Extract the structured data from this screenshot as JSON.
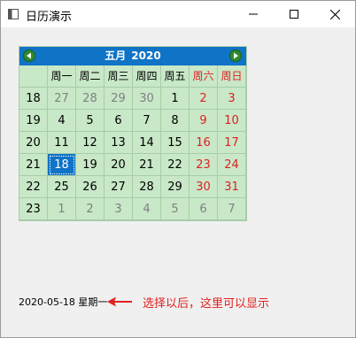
{
  "window": {
    "title": "日历演示"
  },
  "calendar": {
    "month": "五月",
    "year": "2020",
    "weekdays": [
      "周一",
      "周二",
      "周三",
      "周四",
      "周五",
      "周六",
      "周日"
    ],
    "weeks": [
      {
        "num": "18",
        "days": [
          "27",
          "28",
          "29",
          "30",
          "1",
          "2",
          "3"
        ]
      },
      {
        "num": "19",
        "days": [
          "4",
          "5",
          "6",
          "7",
          "8",
          "9",
          "10"
        ]
      },
      {
        "num": "20",
        "days": [
          "11",
          "12",
          "13",
          "14",
          "15",
          "16",
          "17"
        ]
      },
      {
        "num": "21",
        "days": [
          "18",
          "19",
          "20",
          "21",
          "22",
          "23",
          "24"
        ]
      },
      {
        "num": "22",
        "days": [
          "25",
          "26",
          "27",
          "28",
          "29",
          "30",
          "31"
        ]
      },
      {
        "num": "23",
        "days": [
          "1",
          "2",
          "3",
          "4",
          "5",
          "6",
          "7"
        ]
      }
    ],
    "selected_date": "18"
  },
  "status": {
    "text": "2020-05-18 星期一"
  },
  "annotation": {
    "text": "选择以后，这里可以显示"
  },
  "colors": {
    "header_bg": "#0f73c6",
    "calendar_bg": "#c8e8c8",
    "weekend": "#e02020",
    "other_month": "#808080",
    "selected_bg": "#0f73c6",
    "annotation": "#e02020"
  }
}
